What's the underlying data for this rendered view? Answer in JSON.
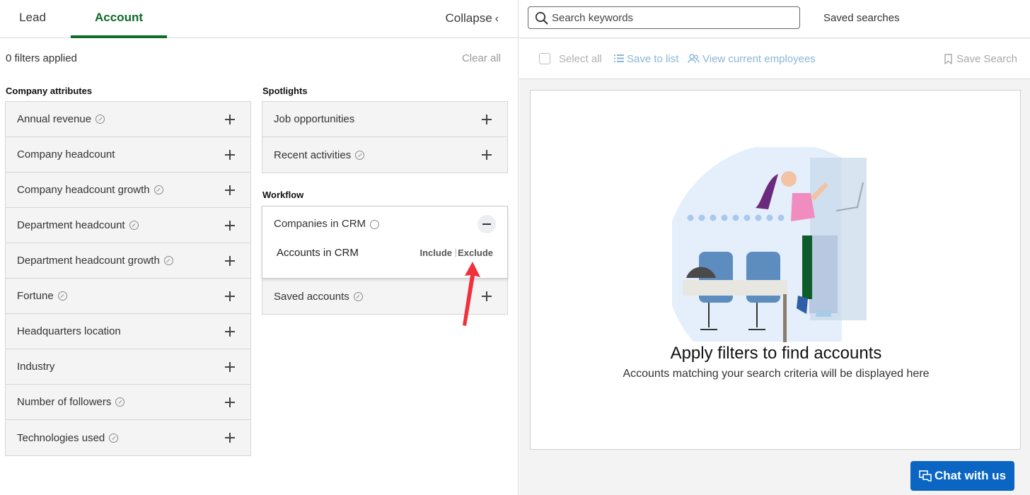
{
  "tabs": {
    "lead": "Lead",
    "account": "Account",
    "collapse": "Collapse"
  },
  "filters": {
    "count_label": "0 filters applied",
    "clear_all": "Clear all"
  },
  "company_attributes": {
    "heading": "Company attributes",
    "items": [
      {
        "label": "Annual revenue",
        "spark": true
      },
      {
        "label": "Company headcount",
        "spark": false
      },
      {
        "label": "Company headcount growth",
        "spark": true
      },
      {
        "label": "Department headcount",
        "spark": true
      },
      {
        "label": "Department headcount growth",
        "spark": true
      },
      {
        "label": "Fortune",
        "spark": true
      },
      {
        "label": "Headquarters location",
        "spark": false
      },
      {
        "label": "Industry",
        "spark": false
      },
      {
        "label": "Number of followers",
        "spark": true
      },
      {
        "label": "Technologies used",
        "spark": true
      }
    ]
  },
  "spotlights": {
    "heading": "Spotlights",
    "items": [
      {
        "label": "Job opportunities",
        "spark": false
      },
      {
        "label": "Recent activities",
        "spark": true
      }
    ]
  },
  "workflow": {
    "heading": "Workflow",
    "expanded": {
      "label": "Companies in CRM",
      "option_label": "Accounts in CRM",
      "include": "Include",
      "separator": "|",
      "exclude": "Exclude"
    },
    "items": [
      {
        "label": "Saved accounts",
        "spark": true
      }
    ]
  },
  "search": {
    "placeholder": "Search keywords",
    "value": "",
    "saved_searches": "Saved searches"
  },
  "toolbar": {
    "select_all": "Select all",
    "save_to_list": "Save to list",
    "view_current_employees": "View current employees",
    "save_search": "Save Search"
  },
  "results": {
    "title": "Apply filters to find accounts",
    "subtitle": "Accounts matching your search criteria will be displayed here"
  },
  "chat": {
    "label": "Chat with us"
  },
  "colors": {
    "accent_green": "#0e6b28",
    "brand_blue": "#0a66c2",
    "annotation_arrow": "#f0303a"
  },
  "icons": [
    "search-icon",
    "list-icon",
    "people-icon",
    "bookmark-icon",
    "chat-icon",
    "plus-icon",
    "minus-icon",
    "spark-icon",
    "chevron-left-icon"
  ]
}
